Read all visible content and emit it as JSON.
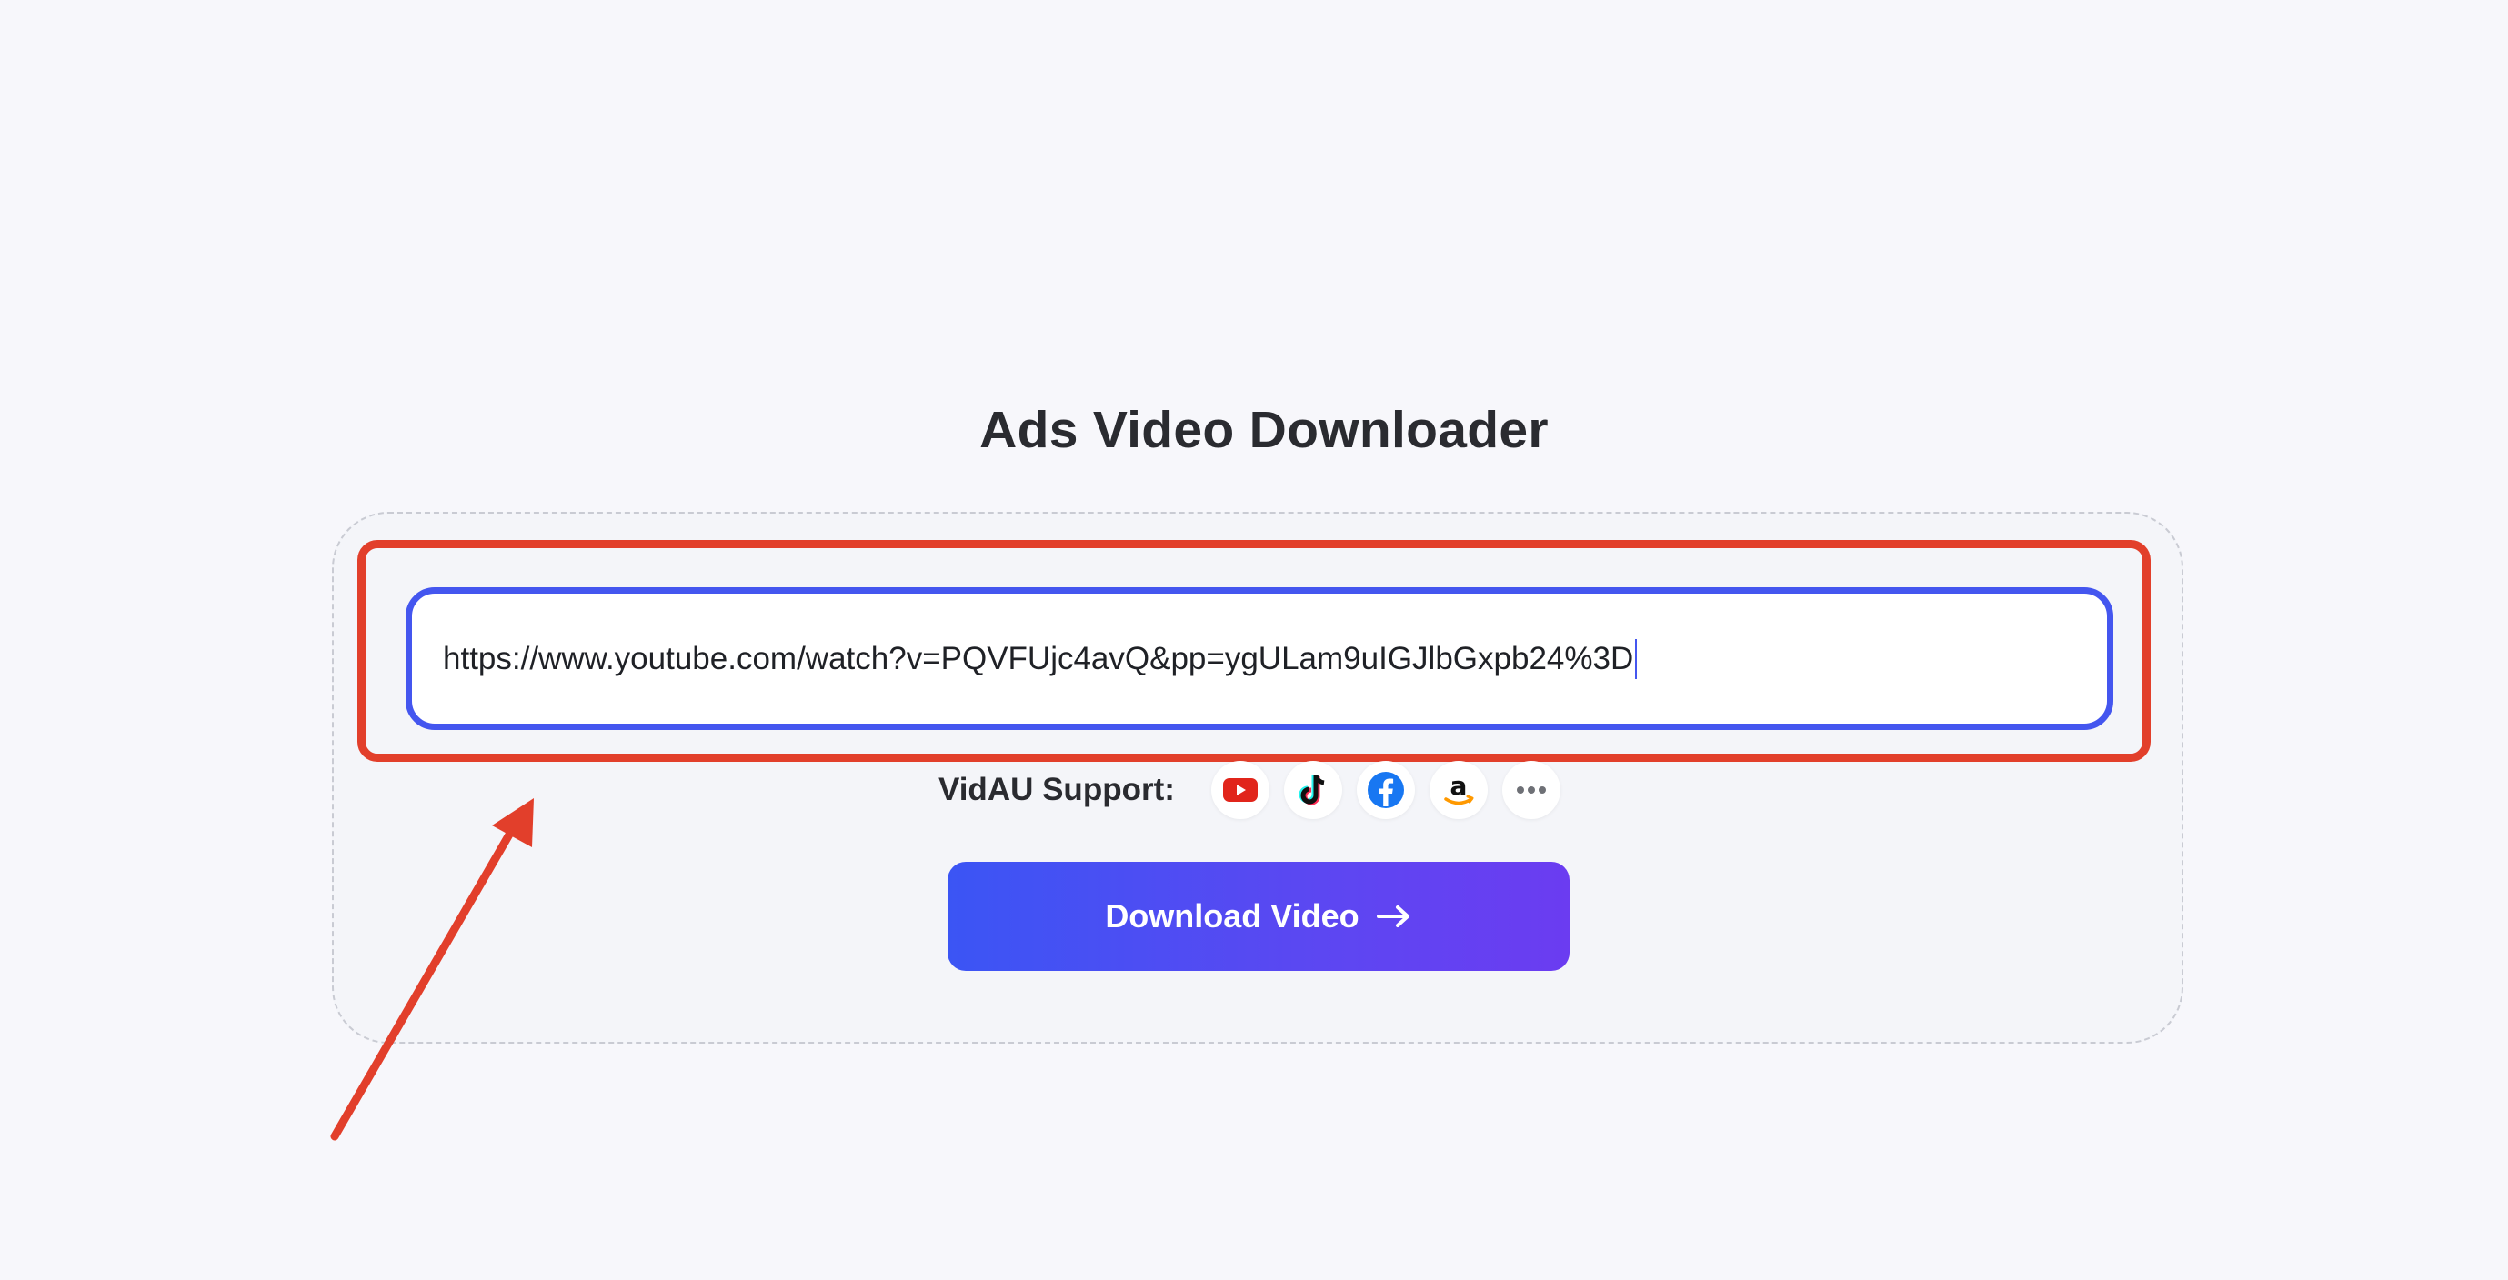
{
  "page": {
    "title": "Ads Video Downloader"
  },
  "url_input": {
    "value": "https://www.youtube.com/watch?v=PQVFUjc4avQ&pp=ygULam9uIGJlbGxpb24%3D"
  },
  "support": {
    "label": "VidAU Support:",
    "platforms": [
      {
        "name": "youtube",
        "icon": "youtube-icon"
      },
      {
        "name": "tiktok",
        "icon": "tiktok-icon"
      },
      {
        "name": "facebook",
        "icon": "facebook-icon"
      },
      {
        "name": "amazon",
        "icon": "amazon-icon"
      },
      {
        "name": "more",
        "icon": "more-icon"
      }
    ]
  },
  "actions": {
    "download_label": "Download Video"
  },
  "colors": {
    "accent_border": "#4456ef",
    "highlight_annotation": "#e23f2b",
    "button_gradient_start": "#3b55f4",
    "button_gradient_end": "#6b3cf1"
  }
}
